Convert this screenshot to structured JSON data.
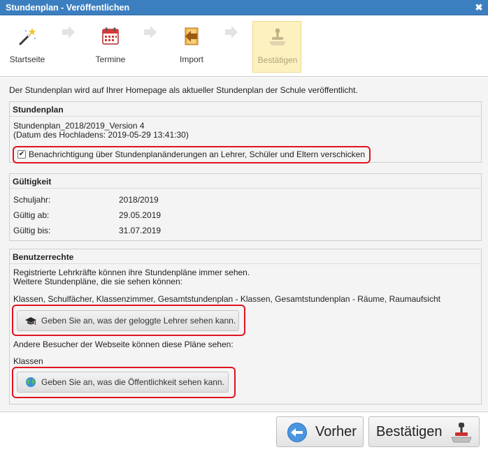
{
  "window": {
    "title": "Stundenplan - Veröffentlichen",
    "close_glyph": "✖"
  },
  "wizard": {
    "steps": [
      {
        "label": "Startseite",
        "icon": "magic-wand-icon"
      },
      {
        "label": "Termine",
        "icon": "calendar-icon"
      },
      {
        "label": "Import",
        "icon": "import-icon"
      },
      {
        "label": "Bestätigen",
        "icon": "stamp-icon",
        "active": true
      }
    ]
  },
  "intro": "Der Stundenplan wird auf Ihrer Homepage als aktueller Stundenplan der Schule veröffentlicht.",
  "stundenplan": {
    "heading": "Stundenplan",
    "name": "Stundenplan_2018/2019_Version 4",
    "upload_date": "(Datum des Hochladens: 2019-05-29 13:41:30)",
    "notify_label": "Benachrichtigung über Stundenplanänderungen an Lehrer, Schüler und Eltern verschicken",
    "notify_checked": true
  },
  "gueltigkeit": {
    "heading": "Gültigkeit",
    "rows": [
      {
        "label": "Schuljahr:",
        "value": "2018/2019"
      },
      {
        "label": "Gültig ab:",
        "value": "29.05.2019"
      },
      {
        "label": "Gültig bis:",
        "value": "31.07.2019"
      }
    ]
  },
  "rechte": {
    "heading": "Benutzerrechte",
    "line1": "Registrierte Lehrkräfte können ihre Stundenpläne immer sehen.",
    "line2": "Weitere Stundenpläne, die sie sehen können:",
    "teacher_plans": "Klassen, Schulfächer, Klassenzimmer, Gesamtstundenplan - Klassen, Gesamtstundenplan - Räume, Raumaufsicht",
    "teacher_button": "Geben Sie an, was der geloggte Lehrer sehen kann.",
    "visitors_line": "Andere Besucher der Webseite können diese Pläne sehen:",
    "visitor_plans": "Klassen",
    "public_button": "Geben Sie an, was die Öffentlichkeit sehen kann."
  },
  "footer": {
    "back_label": "Vorher",
    "confirm_label": "Bestätigen"
  },
  "colors": {
    "titlebar": "#3c7fc0",
    "highlight": "#e0141e",
    "active_step": "#fdf1bf"
  }
}
